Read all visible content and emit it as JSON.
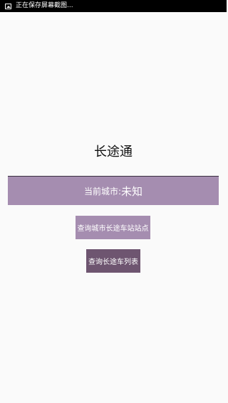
{
  "status_bar": {
    "icon": "screenshot-icon",
    "text": "正在保存屏幕截图..."
  },
  "app": {
    "title": "长途通",
    "city_label": "当前城市:",
    "city_value": "未知",
    "buttons": {
      "stations": "查询城市长途车站站点",
      "routes": "查询长途车列表"
    }
  },
  "colors": {
    "accent_light": "#a58db0",
    "accent_dark": "#6e5570",
    "background": "#fafafa",
    "status_bar": "#000000"
  }
}
